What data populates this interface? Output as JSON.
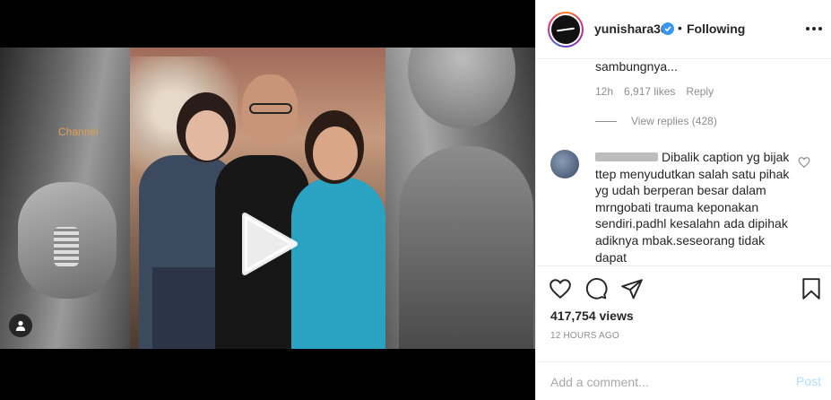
{
  "media": {
    "watermark": "Channel",
    "play_icon": "play-icon",
    "user_tag_icon": "user-icon"
  },
  "header": {
    "username": "yunishara36",
    "verified_icon": "verified-badge-icon",
    "separator": "•",
    "follow_status": "Following",
    "more_icon": "more-options-icon"
  },
  "comments": {
    "first": {
      "text_tail": "sambungnya...",
      "age": "12h",
      "likes": "6,917 likes",
      "reply_label": "Reply",
      "view_replies": "View replies (428)"
    },
    "second": {
      "text": "Dibalik caption yg bijak ttep menyudutkan salah satu pihak yg udah berperan besar dalam mrngobati trauma keponakan sendiri.padhl kesalahn ada dipihak adiknya mbak.seseorang tidak dapat",
      "like_icon": "heart-icon"
    }
  },
  "actions": {
    "like_icon": "heart-icon",
    "comment_icon": "comment-icon",
    "share_icon": "share-icon",
    "save_icon": "bookmark-icon",
    "views": "417,754 views",
    "time_ago": "12 HOURS AGO"
  },
  "comment_box": {
    "placeholder": "Add a comment...",
    "post_label": "Post"
  },
  "colors": {
    "link_blue": "#3897f0",
    "post_disabled": "#b2dffc",
    "muted": "#8e8e8e"
  }
}
